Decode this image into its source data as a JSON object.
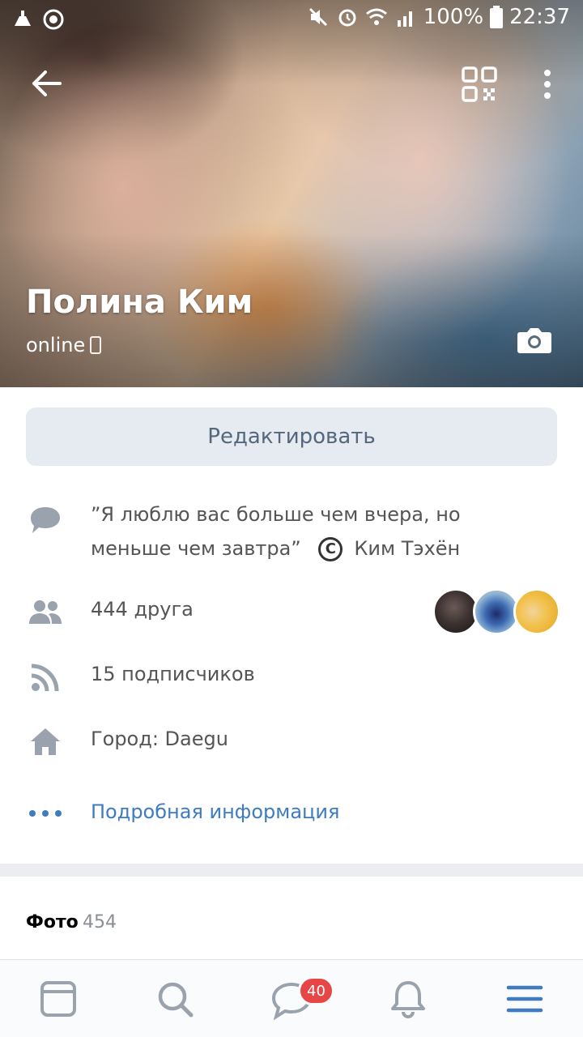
{
  "status_bar": {
    "battery": "100%",
    "time": "22:37"
  },
  "profile": {
    "name": "Полина Ким",
    "online_status": "online"
  },
  "actions": {
    "edit_label": "Редактировать"
  },
  "info": {
    "status_quote": "”Я люблю вас больше чем вчера, но меньше чем завтра”",
    "status_copyright_symbol": "C",
    "status_author": "Ким Тэхён",
    "friends": "444 друга",
    "followers": "15 подписчиков",
    "city": "Город: Daegu",
    "more_info": "Подробная информация"
  },
  "photos": {
    "title": "Фото",
    "count": "454"
  },
  "bottom_nav": {
    "messages_badge": "40"
  },
  "colors": {
    "accent": "#3f7bc1",
    "badge": "#e64646",
    "icon_gray": "#99a2ad",
    "edit_button_bg": "#e5ebf1"
  }
}
